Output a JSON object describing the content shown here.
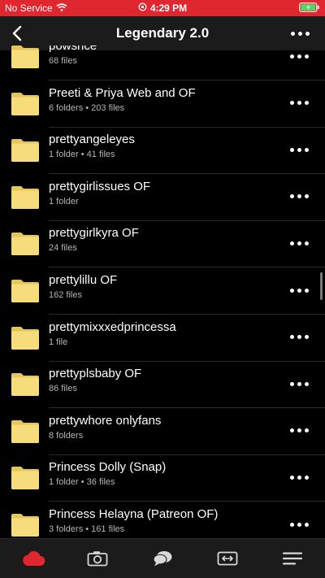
{
  "status_bar": {
    "carrier": "No Service",
    "time": "4:29 PM",
    "background_color": "#e0262f",
    "icons": [
      "wifi-icon",
      "alarm-icon",
      "battery-charging-icon"
    ]
  },
  "nav": {
    "back_icon": "chevron-left-icon",
    "title": "Legendary 2.0",
    "more_icon": "ellipsis-icon"
  },
  "folders": [
    {
      "name": "powsrice",
      "meta": "68 files"
    },
    {
      "name": "Preeti & Priya Web and OF",
      "meta": "6 folders • 203 files"
    },
    {
      "name": "prettyangeleyes",
      "meta": "1 folder • 41 files"
    },
    {
      "name": "prettygirlissues OF",
      "meta": "1 folder"
    },
    {
      "name": "prettygirlkyra OF",
      "meta": "24 files"
    },
    {
      "name": "prettylillu OF",
      "meta": "162 files"
    },
    {
      "name": "prettymixxxedprincessa",
      "meta": "1 file"
    },
    {
      "name": "prettyplsbaby OF",
      "meta": "86 files"
    },
    {
      "name": "prettywhore onlyfans",
      "meta": "8 folders"
    },
    {
      "name": "Princess Dolly (Snap)",
      "meta": "1 folder • 36 files"
    },
    {
      "name": "Princess Helayna (Patreon OF)",
      "meta": "3 folders • 161 files"
    }
  ],
  "tab_bar": {
    "tabs": [
      "cloud-icon",
      "camera-icon",
      "chat-icon",
      "transfer-icon",
      "menu-icon"
    ],
    "active_color": "#e0262f"
  },
  "colors": {
    "folder": "#f6dc7a",
    "folder_dark": "#e6c65a",
    "accent": "#e0262f"
  }
}
